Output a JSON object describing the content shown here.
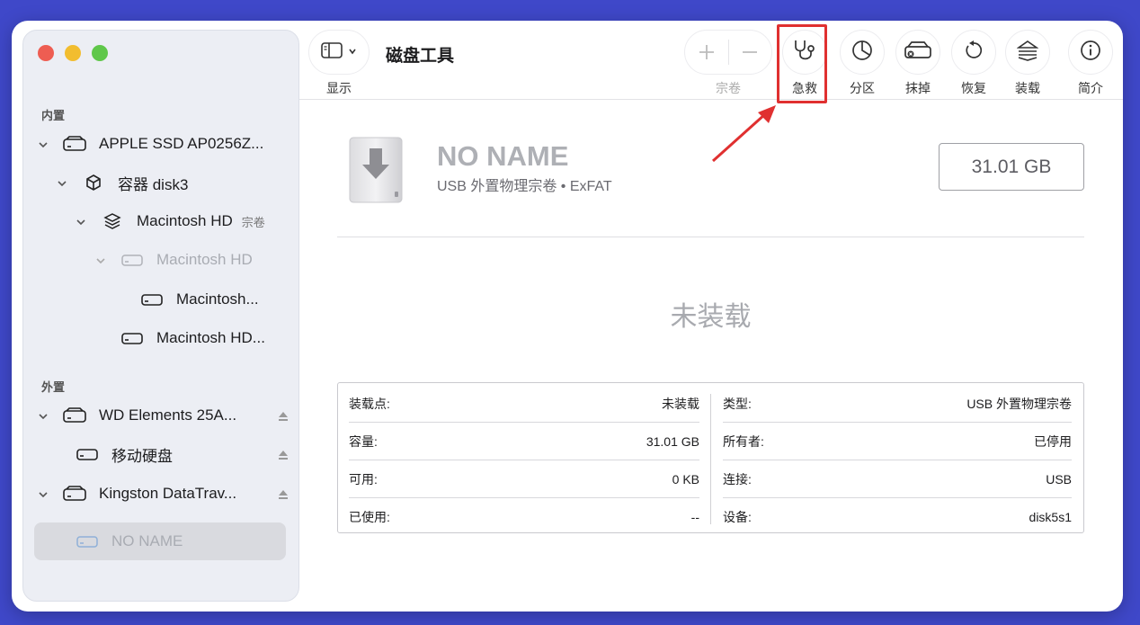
{
  "sidebar": {
    "internal_label": "内置",
    "external_label": "外置",
    "items": [
      {
        "label": "APPLE SSD AP0256Z..."
      },
      {
        "label": "容器 disk3"
      },
      {
        "label": "Macintosh HD",
        "tag": "宗卷"
      },
      {
        "label": "Macintosh HD"
      },
      {
        "label": "Macintosh..."
      },
      {
        "label": "Macintosh HD..."
      },
      {
        "label": "WD Elements 25A..."
      },
      {
        "label": "移动硬盘"
      },
      {
        "label": "Kingston DataTrav..."
      },
      {
        "label": "NO NAME"
      }
    ]
  },
  "toolbar": {
    "view_label": "显示",
    "title": "磁盘工具",
    "volume_label": "宗卷",
    "first_aid_label": "急救",
    "partition_label": "分区",
    "erase_label": "抹掉",
    "restore_label": "恢复",
    "mount_label": "装载",
    "info_label": "简介"
  },
  "disk": {
    "name": "NO NAME",
    "subtitle": "USB 外置物理宗卷 • ExFAT",
    "size": "31.01 GB",
    "status": "未装载"
  },
  "info": {
    "left": [
      {
        "key": "装载点:",
        "value": "未装载"
      },
      {
        "key": "容量:",
        "value": "31.01 GB"
      },
      {
        "key": "可用:",
        "value": "0 KB"
      },
      {
        "key": "已使用:",
        "value": "--"
      }
    ],
    "right": [
      {
        "key": "类型:",
        "value": "USB 外置物理宗卷"
      },
      {
        "key": "所有者:",
        "value": "已停用"
      },
      {
        "key": "连接:",
        "value": "USB"
      },
      {
        "key": "设备:",
        "value": "disk5s1"
      }
    ]
  },
  "colors": {
    "background": "#3f48c9",
    "highlight": "#e03030",
    "sidebar": "#eceef4"
  }
}
